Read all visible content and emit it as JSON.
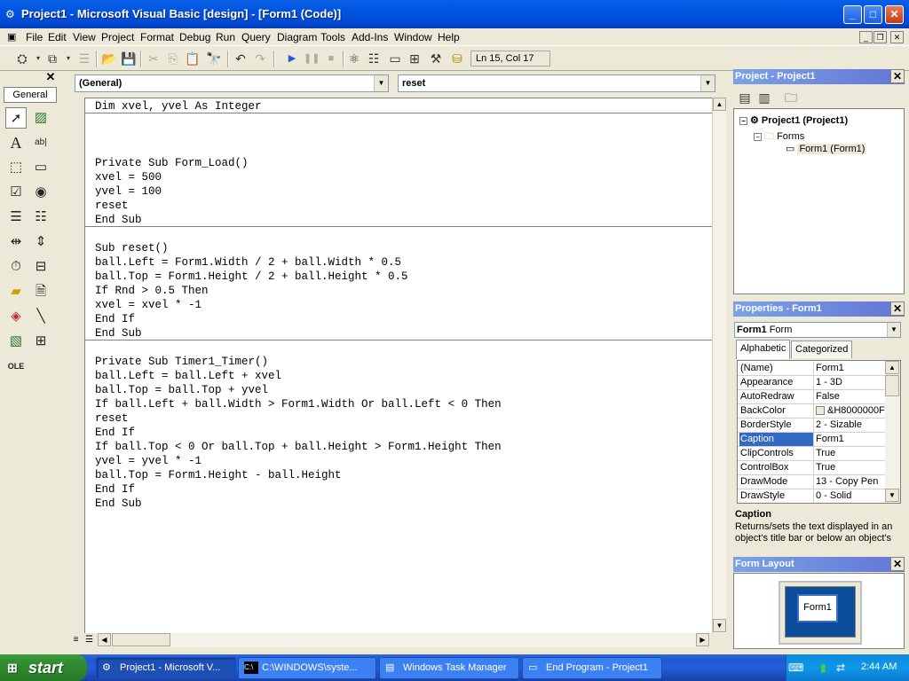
{
  "window": {
    "title": "Project1 - Microsoft Visual Basic [design] - [Form1 (Code)]",
    "title_icon": "vb-app-icon",
    "min_label": "_",
    "max_label": "□",
    "close_label": "✕"
  },
  "menu": {
    "items": [
      "File",
      "Edit",
      "View",
      "Project",
      "Format",
      "Debug",
      "Run",
      "Query",
      "Diagram",
      "Tools",
      "Add-Ins",
      "Window",
      "Help"
    ],
    "mdi_min": "_",
    "mdi_restore": "❐",
    "mdi_close": "✕"
  },
  "toolbar": {
    "cursor_position": "Ln 15, Col 17"
  },
  "toolbox": {
    "tab_label": "General",
    "close_label": "✕"
  },
  "code": {
    "object_combo": "(General)",
    "procedure_combo": "reset",
    "lines": [
      "Dim xvel, yvel As Integer",
      "Private Sub Form_Load()",
      "xvel = 500",
      "yvel = 100",
      "reset",
      "End Sub",
      "Sub reset()",
      "ball.Left = Form1.Width / 2 + ball.Width * 0.5",
      "ball.Top = Form1.Height / 2 + ball.Height * 0.5",
      "If Rnd > 0.5 Then",
      "xvel = xvel * -1",
      "End If",
      "End Sub",
      "Private Sub Timer1_Timer()",
      "ball.Left = ball.Left + xvel",
      "ball.Top = ball.Top + yvel",
      "If ball.Left + ball.Width > Form1.Width Or ball.Left < 0 Then",
      "reset",
      "End If",
      "If ball.Top < 0 Or ball.Top + ball.Height > Form1.Height Then",
      "yvel = yvel * -1",
      "ball.Top = Form1.Height - ball.Height",
      "End If",
      "End Sub"
    ]
  },
  "project": {
    "title": "Project - Project1",
    "root": "Project1 (Project1)",
    "folder": "Forms",
    "item": "Form1 (Form1)"
  },
  "properties": {
    "title": "Properties - Form1",
    "object_name": "Form1",
    "object_type": "Form",
    "tabs": [
      "Alphabetic",
      "Categorized"
    ],
    "rows": [
      {
        "name": "(Name)",
        "value": "Form1"
      },
      {
        "name": "Appearance",
        "value": "1 - 3D"
      },
      {
        "name": "AutoRedraw",
        "value": "False"
      },
      {
        "name": "BackColor",
        "value": "&H8000000F"
      },
      {
        "name": "BorderStyle",
        "value": "2 - Sizable"
      },
      {
        "name": "Caption",
        "value": "Form1"
      },
      {
        "name": "ClipControls",
        "value": "True"
      },
      {
        "name": "ControlBox",
        "value": "True"
      },
      {
        "name": "DrawMode",
        "value": "13 - Copy Pen"
      },
      {
        "name": "DrawStyle",
        "value": "0 - Solid"
      }
    ],
    "selected": "Caption",
    "desc_title": "Caption",
    "desc_text": "Returns/sets the text displayed in an object's title bar or below an object's"
  },
  "form_layout": {
    "title": "Form Layout",
    "form_label": "Form1"
  },
  "taskbar": {
    "start_label": "start",
    "tasks": [
      {
        "label": "Project1 - Microsoft V...",
        "active": true
      },
      {
        "label": "C:\\WINDOWS\\syste...",
        "active": false
      },
      {
        "label": "Windows Task Manager",
        "active": false
      },
      {
        "label": "End Program - Project1",
        "active": false
      }
    ],
    "clock": "2:44 AM"
  }
}
